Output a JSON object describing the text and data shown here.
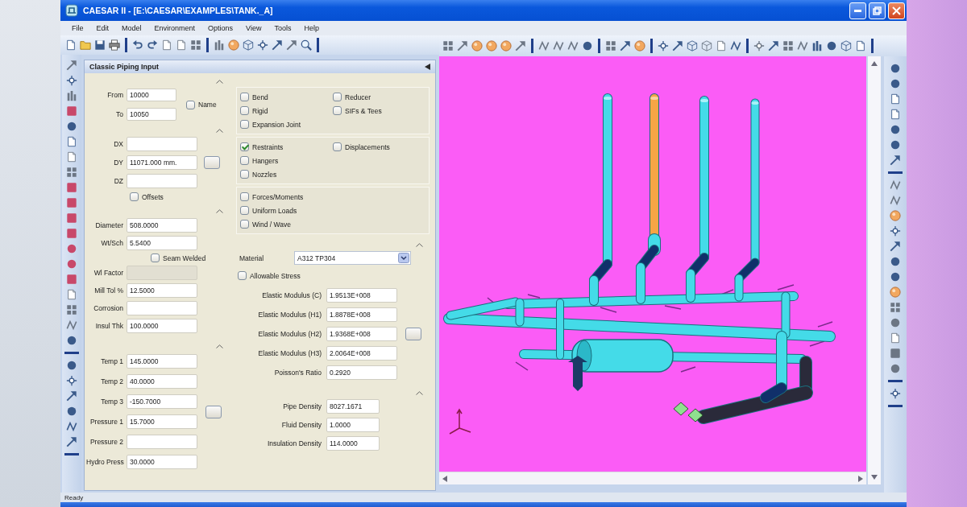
{
  "window": {
    "title": "CAESAR II - [E:\\CAESAR\\EXAMPLES\\TANK._A]"
  },
  "menu": [
    "File",
    "Edit",
    "Model",
    "Environment",
    "Options",
    "View",
    "Tools",
    "Help"
  ],
  "panel": {
    "title": "Classic Piping Input"
  },
  "node_group": {
    "fields": [
      {
        "label": "From",
        "value": "10000"
      },
      {
        "label": "To",
        "value": "10050"
      }
    ],
    "name_option": {
      "label": "Name",
      "checked": false
    }
  },
  "delta_group": {
    "fields": [
      {
        "label": "DX"
      },
      {
        "label": "DY",
        "value": "11071.000 mm."
      },
      {
        "label": "DZ"
      }
    ],
    "offsets_option": {
      "label": "Offsets",
      "checked": false
    }
  },
  "pipe_group": {
    "fields": [
      {
        "label": "Diameter",
        "value": "508.0000"
      },
      {
        "label": "Wt/Sch",
        "value": "5.5400"
      }
    ],
    "seam_welded_option": {
      "label": "Seam Welded",
      "checked": false
    },
    "more_fields": [
      {
        "label": "Wl Factor",
        "disabled": true
      },
      {
        "label": "Mill Tol %",
        "value": "12.5000",
        "disabled": false
      },
      {
        "label": "Corrosion",
        "disabled": false
      },
      {
        "label": "Insul Thk",
        "value": "100.0000",
        "disabled": false
      }
    ]
  },
  "operating_group": {
    "fields": [
      {
        "label": "Temp 1",
        "value": "145.0000"
      },
      {
        "label": "Temp 2",
        "value": "40.0000"
      },
      {
        "label": "Temp 3",
        "value": "-150.7000"
      },
      {
        "label": "Pressure 1",
        "value": "15.7000"
      },
      {
        "label": "Pressure 2"
      },
      {
        "label": "Hydro Press",
        "value": "30.0000"
      }
    ]
  },
  "option_groups": [
    {
      "columns": [
        [
          {
            "label": "Bend",
            "checked": false
          },
          {
            "label": "Rigid",
            "checked": false
          },
          {
            "label": "Expansion Joint",
            "checked": false
          }
        ],
        [
          {
            "label": "Reducer",
            "checked": false
          },
          {
            "label": "SIFs & Tees",
            "checked": false
          }
        ]
      ]
    },
    {
      "columns": [
        [
          {
            "label": "Restraints",
            "checked": true
          },
          {
            "label": "Hangers",
            "checked": false
          },
          {
            "label": "Nozzles",
            "checked": false
          }
        ],
        [
          {
            "label": "Displacements",
            "checked": false
          }
        ]
      ]
    },
    {
      "columns": [
        [
          {
            "label": "Forces/Moments",
            "checked": false
          },
          {
            "label": "Uniform Loads",
            "checked": false
          },
          {
            "label": "Wind / Wave",
            "checked": false
          }
        ]
      ]
    }
  ],
  "material": {
    "label": "Material",
    "value": "A312 TP304"
  },
  "allowable_stress": {
    "label": "Allowable Stress",
    "checked": false
  },
  "modulus_fields": [
    {
      "label": "Elastic Modulus (C)",
      "value": "1.9513E+008"
    },
    {
      "label": "Elastic Modulus (H1)",
      "value": "1.8878E+008"
    },
    {
      "label": "Elastic Modulus (H2)",
      "value": "1.9368E+008"
    },
    {
      "label": "Elastic Modulus (H3)",
      "value": "2.0064E+008"
    },
    {
      "label": "Poisson's Ratio",
      "value": "0.2920"
    }
  ],
  "density_fields": [
    {
      "label": "Pipe Density",
      "value": "8027.1671"
    },
    {
      "label": "Fluid Density",
      "value": "1.0000"
    },
    {
      "label": "Insulation Density",
      "value": "114.0000"
    }
  ],
  "status_bar": {
    "text": "Ready"
  }
}
